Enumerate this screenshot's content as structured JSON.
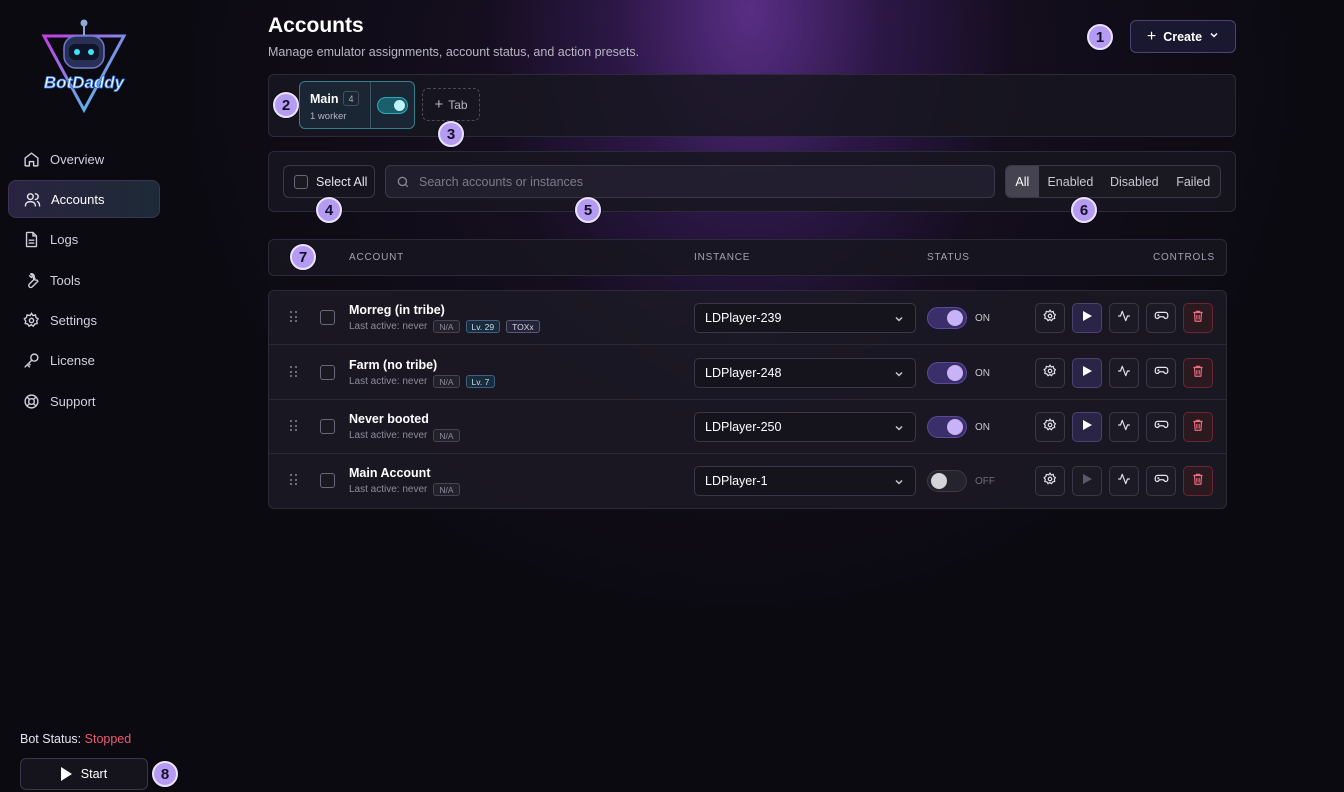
{
  "app": {
    "logo_text": "BotDaddy"
  },
  "sidebar": {
    "items": [
      {
        "label": "Overview",
        "icon": "home-icon",
        "active": false
      },
      {
        "label": "Accounts",
        "icon": "users-icon",
        "active": true
      },
      {
        "label": "Logs",
        "icon": "file-icon",
        "active": false
      },
      {
        "label": "Tools",
        "icon": "wrench-icon",
        "active": false
      },
      {
        "label": "Settings",
        "icon": "gear-icon",
        "active": false
      },
      {
        "label": "License",
        "icon": "key-icon",
        "active": false
      },
      {
        "label": "Support",
        "icon": "lifebuoy-icon",
        "active": false
      }
    ],
    "bot_status_label": "Bot Status:",
    "bot_status_value": "Stopped",
    "start_label": "Start"
  },
  "header": {
    "title": "Accounts",
    "subtitle": "Manage emulator assignments, account status, and action presets.",
    "create_label": "Create"
  },
  "tabs": {
    "items": [
      {
        "name": "Main",
        "count": "4",
        "workers": "1 worker",
        "enabled": true
      }
    ],
    "add_label": "Tab"
  },
  "filters": {
    "select_all_label": "Select All",
    "search_placeholder": "Search accounts or instances",
    "search_value": "",
    "segments": [
      "All",
      "Enabled",
      "Disabled",
      "Failed"
    ],
    "active_segment": "All"
  },
  "table": {
    "columns": {
      "account": "ACCOUNT",
      "instance": "INSTANCE",
      "status": "STATUS",
      "controls": "CONTROLS"
    },
    "rows": [
      {
        "name": "Morreg (in tribe)",
        "last_active": "Last active: never",
        "na": "N/A",
        "level": "Lv. 29",
        "tag": "TOXx",
        "instance": "LDPlayer-239",
        "status": "ON",
        "enabled": true
      },
      {
        "name": "Farm (no tribe)",
        "last_active": "Last active: never",
        "na": "N/A",
        "level": "Lv. 7",
        "tag": "",
        "instance": "LDPlayer-248",
        "status": "ON",
        "enabled": true
      },
      {
        "name": "Never booted",
        "last_active": "Last active: never",
        "na": "N/A",
        "level": "",
        "tag": "",
        "instance": "LDPlayer-250",
        "status": "ON",
        "enabled": true
      },
      {
        "name": "Main Account",
        "last_active": "Last active: never",
        "na": "N/A",
        "level": "",
        "tag": "",
        "instance": "LDPlayer-1",
        "status": "OFF",
        "enabled": false
      }
    ]
  },
  "markers": [
    "1",
    "2",
    "3",
    "4",
    "5",
    "6",
    "7",
    "8"
  ],
  "colors": {
    "accent": "#b59cf2",
    "stopped": "#ef5a6f",
    "tab_active_border": "#3a7d8a",
    "delete_border": "#6a2633"
  }
}
